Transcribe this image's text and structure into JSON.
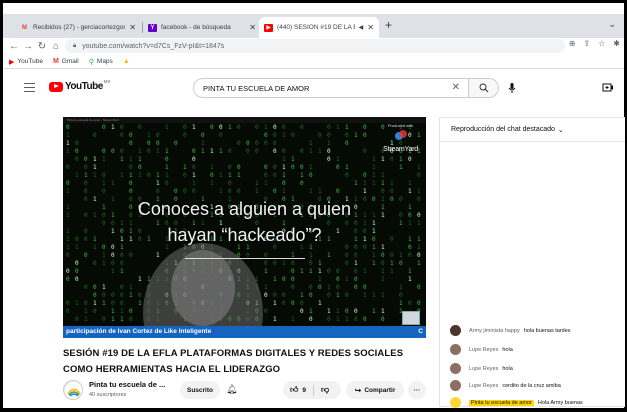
{
  "browser": {
    "tabs": [
      {
        "title": "Recibidos (27) - gerciacortezgon",
        "favicon": "gmail-icon",
        "active": false
      },
      {
        "title": "facebook - de búsqueda",
        "favicon": "yahoo-icon",
        "active": false
      },
      {
        "title": "(440) SESIÓN #19 DE LA EFL",
        "favicon": "youtube-icon",
        "active": true
      }
    ],
    "new_tab": "+",
    "url": "youtube.com/watch?v=d7Cs_FzV-pI&t=1847s",
    "bookmarks": [
      {
        "label": "YouTube",
        "icon": "youtube-icon",
        "color": "#ff0000"
      },
      {
        "label": "Gmail",
        "icon": "gmail-icon",
        "color": "#ea4335"
      },
      {
        "label": "Maps",
        "icon": "maps-icon",
        "color": "#34a853"
      },
      {
        "label": "",
        "icon": "drive-icon",
        "color": "#fbbc04"
      }
    ]
  },
  "youtube": {
    "logo_text": "YouTube",
    "country_code": "MX",
    "search_query": "PINTA TU ESCUELA DE AMOR"
  },
  "video": {
    "window_title": "Pinta tu escuela de amor - StreamYard",
    "produced_with": "Produced with",
    "streamyard_label": "StreamYard",
    "overlay_line1": "Conoces a alguien a quien",
    "overlay_line2": "hayan “hackeado”?",
    "caption": "participación de Ivan Cortez de Like Inteligente",
    "caption_right": "C",
    "title": "SESIÓN #19 DE LA EFLA PLATAFORMAS DIGITALES Y REDES SOCIALES COMO HERRAMIENTAS HACIA EL LIDERAZGO",
    "channel_name": "Pinta tu escuela de ...",
    "subscribers": "40 suscriptores",
    "subscribed_label": "Suscrito",
    "likes": "9",
    "share_label": "Compartir",
    "more_label": "···"
  },
  "chat": {
    "header": "Reproducción del chat destacado",
    "messages": [
      {
        "author": "Army jiminista happy",
        "text": "hola buenas tardes",
        "avatar_color": "#4e342e",
        "owner": false
      },
      {
        "author": "Lupe Reyes",
        "text": "hola",
        "avatar_color": "#8d6e63",
        "owner": false
      },
      {
        "author": "Lupe Reyes",
        "text": "hola",
        "avatar_color": "#8d6e63",
        "owner": false
      },
      {
        "author": "Lupe Reyes",
        "text": "cerdito de la cruz amiba",
        "avatar_color": "#8d6e63",
        "owner": false
      },
      {
        "author": "Pinta tu escuela de amor",
        "text": "Hola Army buenas",
        "avatar_color": "#fdd835",
        "owner": true
      }
    ]
  },
  "colors": {
    "accent_red": "#ff0000",
    "caption_blue": "#1565c0",
    "owner_highlight": "#ffd600"
  }
}
